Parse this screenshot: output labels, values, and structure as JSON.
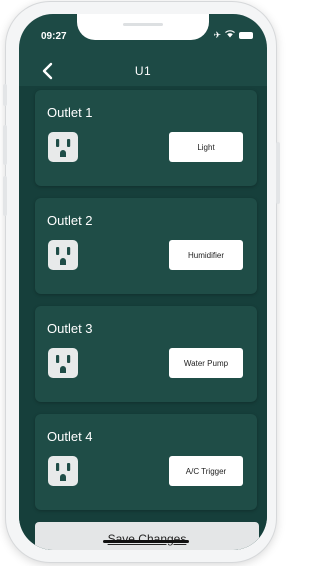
{
  "status": {
    "time": "09:27"
  },
  "nav": {
    "title": "U1"
  },
  "outlets": [
    {
      "label": "Outlet 1",
      "device": "Light"
    },
    {
      "label": "Outlet 2",
      "device": "Humidifier"
    },
    {
      "label": "Outlet 3",
      "device": "Water Pump"
    },
    {
      "label": "Outlet 4",
      "device": "A/C Trigger"
    }
  ],
  "footer": {
    "save_label": "Save Changes"
  },
  "colors": {
    "background": "#1d4a45",
    "card": "#1f4d47",
    "button": "#ffffff",
    "save_bar": "#e4e6e7"
  }
}
